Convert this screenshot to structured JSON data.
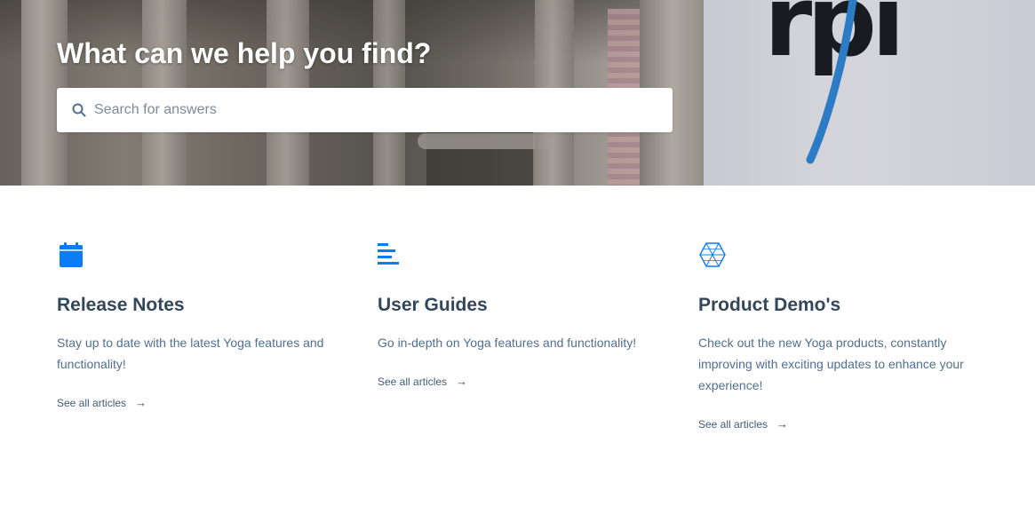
{
  "hero": {
    "title": "What can we help you find?",
    "search": {
      "placeholder": "Search for answers",
      "value": "",
      "icon": "search-icon"
    }
  },
  "categories": [
    {
      "icon": "calendar-icon",
      "title": "Release Notes",
      "description": "Stay up to date with the latest Yoga features and functionality!",
      "link_label": "See all articles",
      "link_arrow": "→"
    },
    {
      "icon": "text-align-left-icon",
      "title": "User Guides",
      "description": "Go in-depth on Yoga features and functionality!",
      "link_label": "See all articles",
      "link_arrow": "→"
    },
    {
      "icon": "hexagon-mesh-icon",
      "title": "Product Demo's",
      "description": "Check out the new Yoga products, constantly improving with exciting updates to enhance your experience!",
      "link_label": "See all articles",
      "link_arrow": "→"
    }
  ],
  "colors": {
    "accent": "#0a7cf4",
    "heading": "#33475b",
    "body_text": "#516f90",
    "link": "#425b76"
  }
}
